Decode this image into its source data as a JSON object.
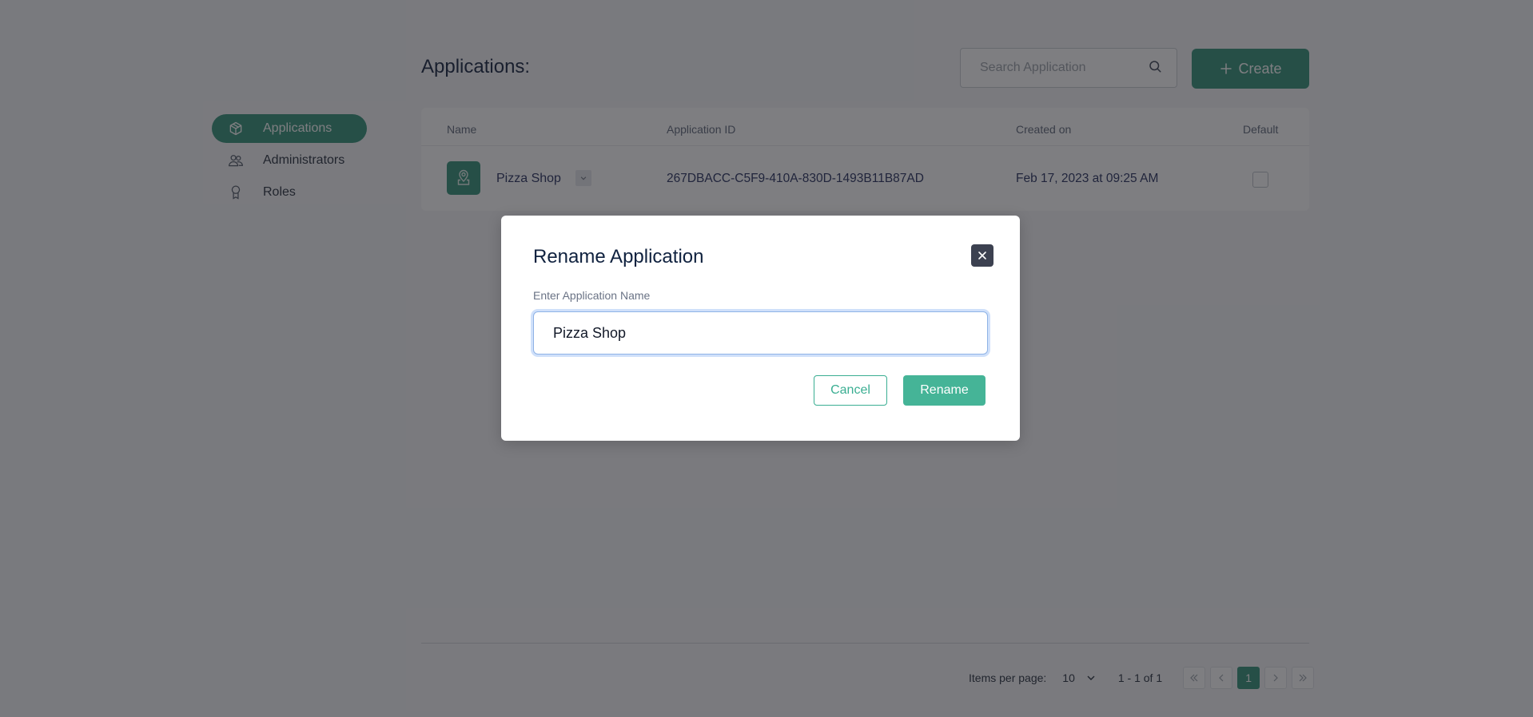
{
  "sidebar": {
    "items": [
      {
        "label": "Applications",
        "icon": "cube-icon",
        "active": true
      },
      {
        "label": "Administrators",
        "icon": "users-icon",
        "active": false
      },
      {
        "label": "Roles",
        "icon": "award-icon",
        "active": false
      }
    ]
  },
  "header": {
    "title": "Applications:",
    "search_placeholder": "Search Application",
    "search_value": "",
    "create_label": "Create"
  },
  "table": {
    "columns": [
      "Name",
      "Application ID",
      "Created on",
      "Default"
    ],
    "rows": [
      {
        "name": "Pizza Shop",
        "icon": "map-pin-icon",
        "application_id": "267DBACC-C5F9-410A-830D-1493B11B87AD",
        "created_on": "Feb 17, 2023 at 09:25 AM",
        "default": false
      }
    ]
  },
  "pagination": {
    "items_per_page_label": "Items per page:",
    "items_per_page": "10",
    "range": "1 - 1 of 1",
    "current_page": "1"
  },
  "modal": {
    "title": "Rename Application",
    "field_label": "Enter Application Name",
    "field_value": "Pizza Shop",
    "cancel_label": "Cancel",
    "rename_label": "Rename"
  },
  "colors": {
    "brand": "#2f8f75",
    "primary_button": "#45b497",
    "close_button": "#3c4150",
    "input_focus": "#8fb3e6"
  }
}
